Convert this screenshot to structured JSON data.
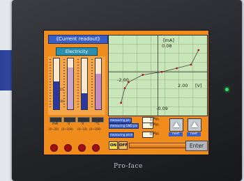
{
  "device": {
    "brand": "Pro-face"
  },
  "screen": {
    "title": "《Current readout》",
    "section_label": "Electricity",
    "bars": [
      {
        "color": "#2a37a0",
        "level": 0.55
      },
      {
        "color": "#c8a4c8",
        "level": 0.82
      },
      {
        "color": "#2a37a0",
        "level": 0.32
      },
      {
        "color": "#c88ac0",
        "level": 0.7
      }
    ],
    "bar_small_labels": [
      "25",
      "100"
    ],
    "units": [
      "mA",
      "V",
      "V",
      "°C"
    ],
    "ranges": [
      "(0~20)",
      "(0~100)",
      "(0~10)",
      "(0~100)"
    ],
    "graph": {
      "y_axis_label": "[mA]",
      "x_axis_label": "[V]",
      "top_value": "0.08",
      "left_value": "-2.00",
      "right_value": "2.00",
      "bottom_value": "-0.09"
    },
    "measurements": [
      {
        "label": "measuring pin",
        "value": "1",
        "unit": "Pin"
      },
      {
        "label": "measuring GND pin",
        "value": "0",
        "unit": "Pin"
      },
      {
        "label": "measuring pitch",
        "value": "0",
        "unit": "Pin"
      }
    ],
    "nav_buttons": [
      "next",
      "next"
    ],
    "toggle": {
      "on": "ON",
      "off": "OFF"
    },
    "enter_label": "Enter"
  },
  "chart_data": {
    "type": "line",
    "xlabel": "[V]",
    "ylabel": "[mA]",
    "xlim": [
      -2.6,
      2.6
    ],
    "ylim": [
      -0.12,
      0.1
    ],
    "series": [
      {
        "x": [
          -1.95,
          -1.75,
          -1.55,
          -0.8,
          0.2,
          1.0,
          1.75,
          2.15
        ],
        "y": [
          -0.085,
          -0.045,
          -0.028,
          -0.008,
          0.0,
          0.01,
          0.02,
          0.06
        ]
      }
    ]
  },
  "colors": {
    "screen_bg": "#f08c1c",
    "graph_bg": "#c8e6b8",
    "accent_blue": "#3a5fc4"
  }
}
